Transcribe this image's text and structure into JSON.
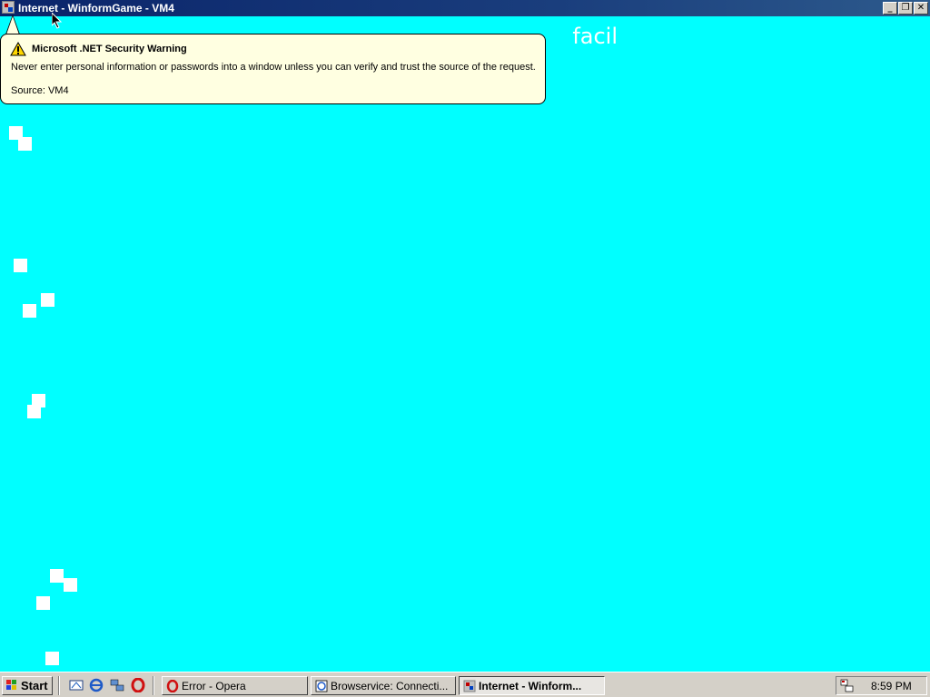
{
  "window": {
    "title": "Internet - WinformGame - VM4",
    "buttons": [
      "minimize",
      "restore",
      "close"
    ]
  },
  "game": {
    "background_color": "#00ffff",
    "banner_text": "facil",
    "square_color": "#ffffff"
  },
  "security_warning": {
    "title": "Microsoft .NET Security Warning",
    "message": "Never enter personal information or passwords into a window unless you can verify and trust the source of the request.",
    "source": "Source: VM4",
    "icon": "warning-icon"
  },
  "taskbar": {
    "start_label": "Start",
    "quick_launch": [
      "show-desktop-icon",
      "internet-explorer-icon",
      "network-icon",
      "opera-icon"
    ],
    "tasks": [
      {
        "label": "Error - Opera",
        "icon": "opera-icon",
        "active": false
      },
      {
        "label": "Browservice: Connecti...",
        "icon": "browser-icon",
        "active": false
      },
      {
        "label": "Internet - Winform...",
        "icon": "app-icon",
        "active": true
      }
    ],
    "tray_icon": "network-tray-icon",
    "clock": "8:59 PM"
  }
}
